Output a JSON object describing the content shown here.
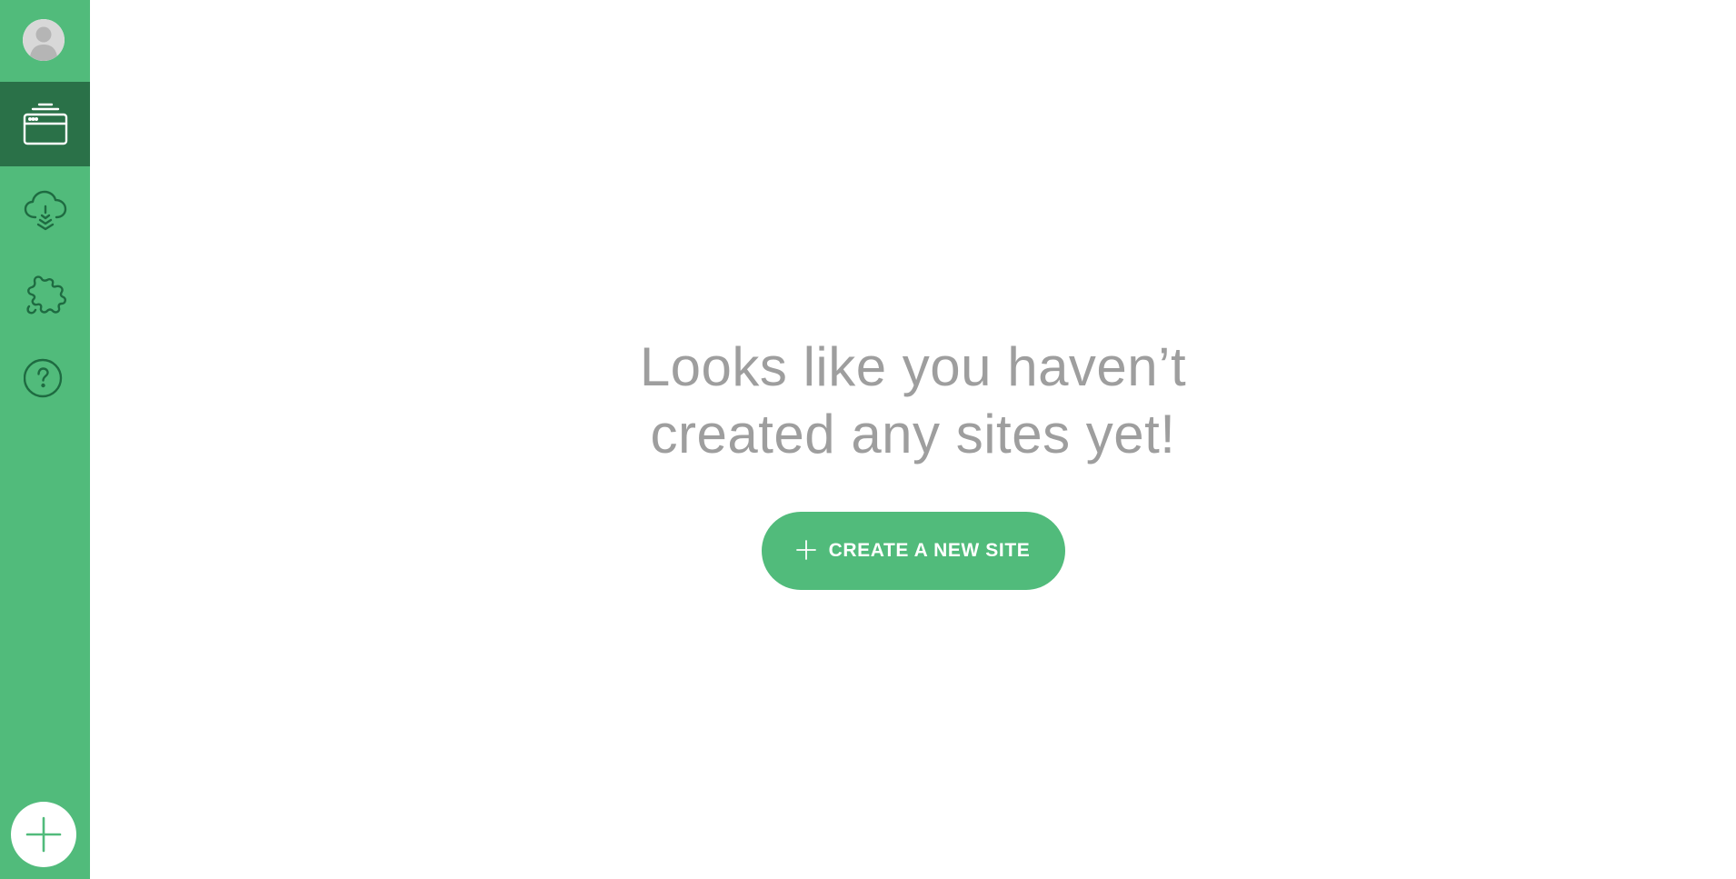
{
  "sidebar": {
    "avatar": {
      "icon": "user-avatar-icon"
    },
    "items": [
      {
        "id": "sites",
        "icon": "browser-window-stack-icon",
        "active": true
      },
      {
        "id": "cloud",
        "icon": "cloud-download-icon",
        "active": false
      },
      {
        "id": "add-ons",
        "icon": "puzzle-piece-icon",
        "active": false
      },
      {
        "id": "help",
        "icon": "question-circle-icon",
        "active": false
      }
    ],
    "add_button": {
      "icon": "plus-icon"
    }
  },
  "empty_state": {
    "headline_line1": "Looks like you haven’t",
    "headline_line2": "created any sites yet!",
    "create_button_label": "CREATE A NEW SITE",
    "create_button_icon": "plus-icon"
  },
  "colors": {
    "brand_green": "#51bb7b",
    "active_green": "#2a7148",
    "icon_dark_green": "#1e6b41",
    "headline_gray": "#9e9e9e",
    "avatar_gray": "#b5b5b5"
  }
}
